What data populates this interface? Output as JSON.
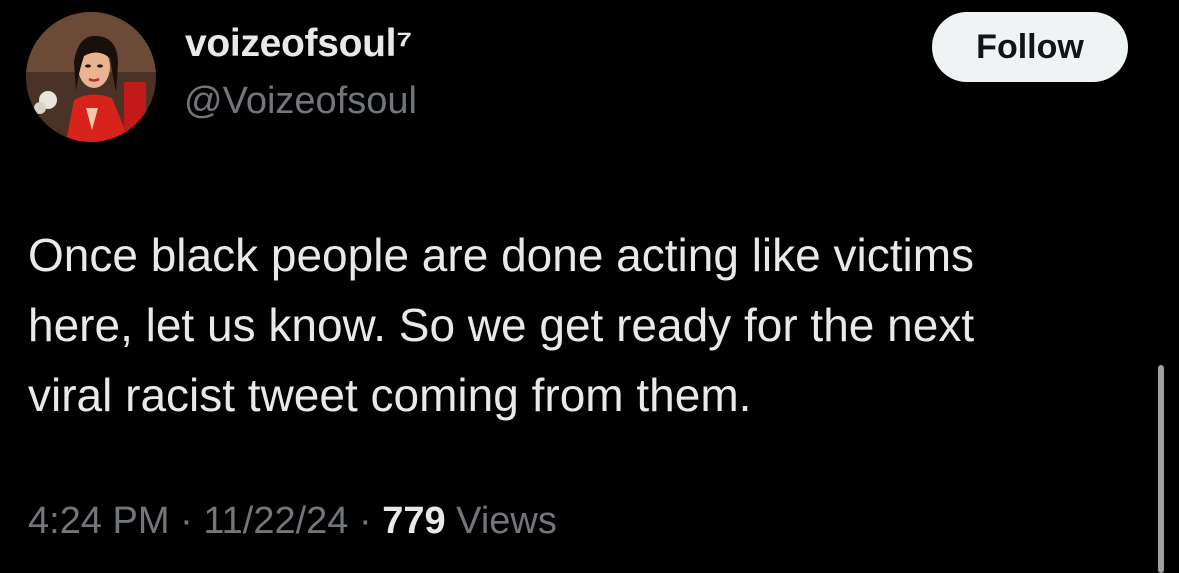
{
  "author": {
    "display_name": "voizeofsoul⁷",
    "handle": "@Voizeofsoul",
    "avatar_icon": "profile-photo-avatar"
  },
  "follow_button": {
    "label": "Follow"
  },
  "tweet": {
    "lines": [
      "Once black people are done acting like victims",
      "here, let us know. So we get ready for the next",
      "viral racist tweet coming from them."
    ]
  },
  "meta": {
    "time": "4:24 PM",
    "separator": " · ",
    "date": "11/22/24",
    "views_count": "779",
    "views_label": " Views"
  },
  "colors": {
    "background": "#000000",
    "primary_text": "#e7e9ea",
    "secondary_text": "#71767b",
    "follow_button_bg": "#eff3f4",
    "follow_button_text": "#0f1419"
  }
}
